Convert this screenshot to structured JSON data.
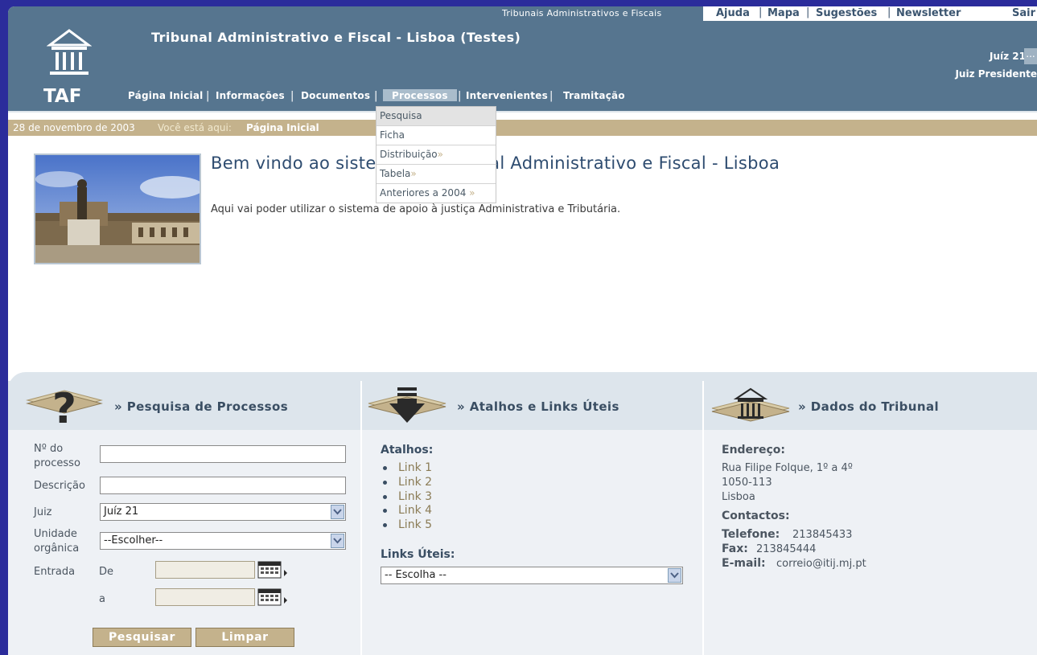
{
  "header": {
    "tribunais_link": "Tribunais Administrativos e Fiscais",
    "top_links": [
      "Ajuda",
      "Mapa",
      "Sugestões",
      "Newsletter",
      "Sair"
    ],
    "site_title": "Tribunal Administrativo e Fiscal - Lisboa (Testes)",
    "user_name": "Juíz 21",
    "user_more": "...",
    "user_role": "Juiz Presidente",
    "logo_text": "TAF",
    "nav": [
      "Página Inicial",
      "Informações",
      "Documentos",
      "Processos",
      "Intervenientes",
      "Tramitação"
    ],
    "nav_active": "Processos"
  },
  "dropdown": {
    "items": [
      {
        "label": "Pesquisa",
        "arrow": ""
      },
      {
        "label": "Ficha",
        "arrow": ""
      },
      {
        "label": "Distribuição",
        "arrow": "»"
      },
      {
        "label": "Tabela",
        "arrow": "»"
      },
      {
        "label": "Anteriores a 2004",
        "arrow": "»"
      }
    ]
  },
  "breadcrumb": {
    "date": "28 de novembro de 2003",
    "you_are_here": "Você está aqui:",
    "current": "Página Inicial"
  },
  "welcome": {
    "title": "Bem vindo ao sistema do Tribunal Administrativo e Fiscal - Lisboa",
    "text": "Aqui vai poder utilizar o sistema de apoio à justiça Administrativa e Tributária."
  },
  "search_panel": {
    "title": "» Pesquisa de Processos",
    "process_no_label_1": "Nº do",
    "process_no_label_2": "processo",
    "description_label": "Descrição",
    "judge_label": "Juiz",
    "judge_value": "Juíz 21",
    "unit_label_1": "Unidade",
    "unit_label_2": "orgânica",
    "unit_value": "--Escolher--",
    "entry_label": "Entrada",
    "from_label": "De",
    "to_label": "a",
    "search_button": "Pesquisar",
    "clear_button": "Limpar"
  },
  "shortcuts_panel": {
    "title": "» Atalhos e Links Úteis",
    "shortcuts_label": "Atalhos:",
    "links": [
      "Link 1",
      "Link 2",
      "Link 3",
      "Link 4",
      "Link 5"
    ],
    "useful_links_label": "Links Úteis:",
    "useful_links_value": "-- Escolha --"
  },
  "court_panel": {
    "title": "» Dados do Tribunal",
    "address_label": "Endereço:",
    "address_line1": "Rua Filipe Folque, 1º a 4º",
    "address_line2": "1050-113",
    "address_line3": "Lisboa",
    "contacts_label": "Contactos:",
    "phone_label": "Telefone:",
    "phone_value": "213845433",
    "fax_label": "Fax:",
    "fax_value": "213845444",
    "email_label": "E-mail:",
    "email_value": "correio@itij.mj.pt"
  },
  "colors": {
    "header": "#56758f",
    "accent": "#c4b28c",
    "outer": "#2b2c9b"
  }
}
